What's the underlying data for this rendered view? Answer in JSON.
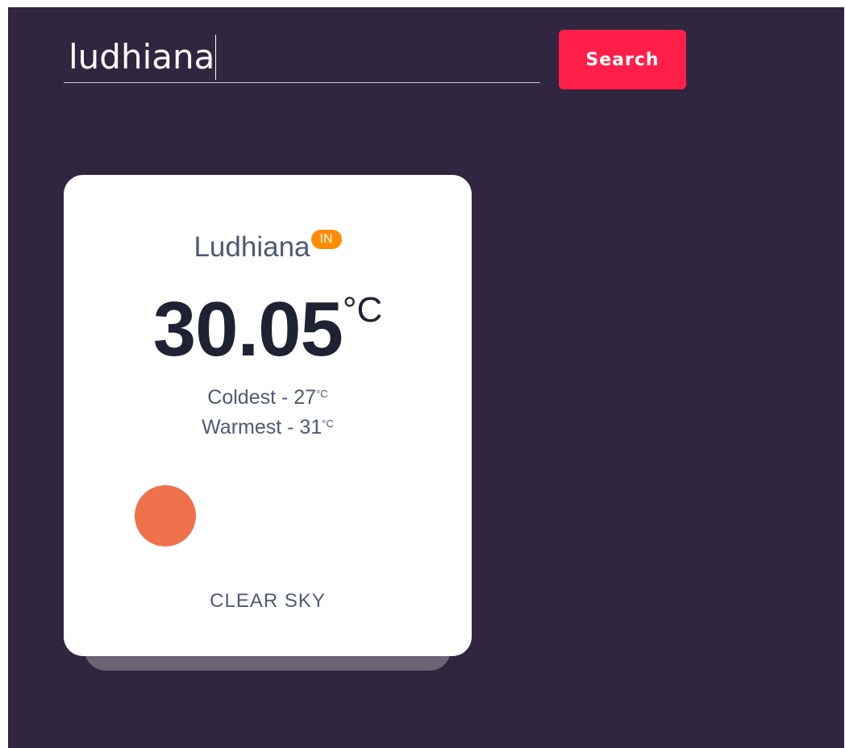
{
  "search": {
    "value": "ludhiana",
    "button_label": "Search"
  },
  "weather": {
    "city": "Ludhiana",
    "country": "IN",
    "temperature": "30.05",
    "unit": "°C",
    "coldest_label": "Coldest - 27",
    "warmest_label": "Warmest - 31",
    "minmax_unit": "°C",
    "description": "CLEAR SKY",
    "icon": "sun-icon"
  },
  "colors": {
    "background": "#302640",
    "accent": "#ff1f48",
    "badge": "#ff8c00",
    "sun": "#ef714c",
    "card": "#ffffff"
  }
}
